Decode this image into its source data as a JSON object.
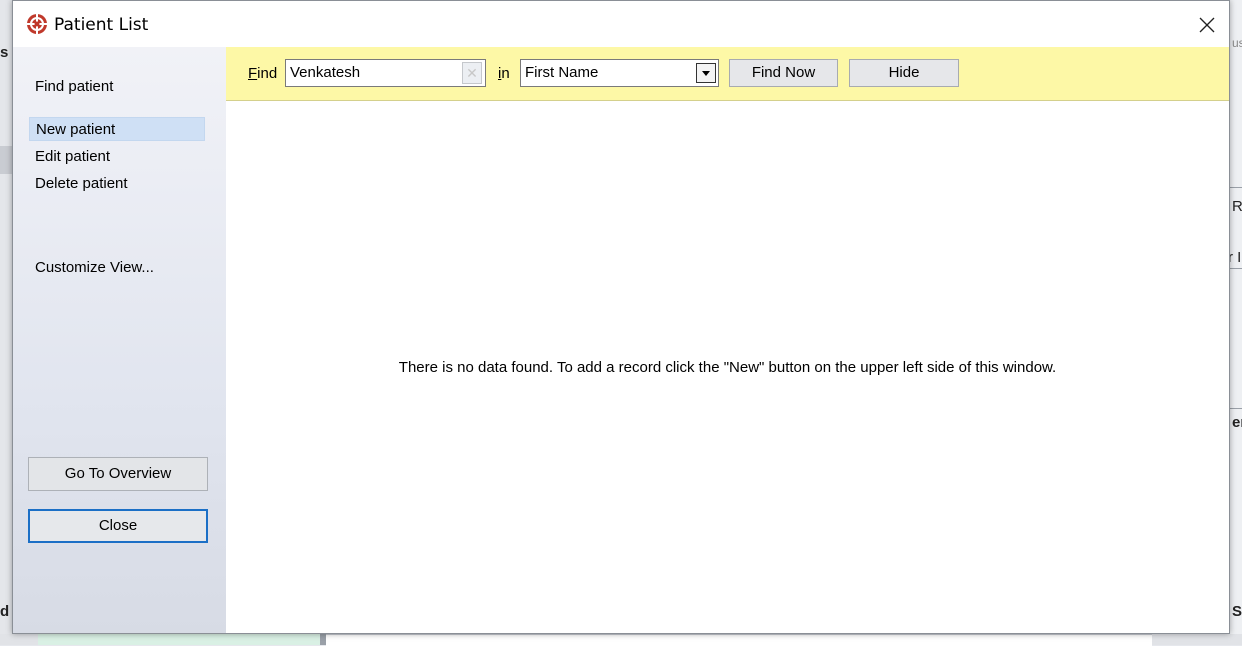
{
  "window": {
    "title": "Patient List"
  },
  "sidebar": {
    "find_patient": "Find patient",
    "new_patient": "New patient",
    "edit_patient": "Edit patient",
    "delete_patient": "Delete patient",
    "customize_view": "Customize View...",
    "go_to_overview": "Go To Overview",
    "close": "Close"
  },
  "find_bar": {
    "find_label_prefix": "F",
    "find_label_rest": "ind",
    "search_value": "Venkatesh",
    "in_label_prefix": "i",
    "in_label_rest": "n",
    "field_selected": "First Name",
    "find_now": "Find Now",
    "hide": "Hide"
  },
  "content": {
    "empty_message": "There is no data found.  To add a record click the \"New\" button on the upper left side of this window."
  },
  "background": {
    "left_fragments": [
      "s",
      "d"
    ],
    "right_fragments": [
      "us",
      "Re",
      "r I",
      "er",
      "S"
    ]
  },
  "colors": {
    "find_bar_bg": "#fdf8a6",
    "selected_item_bg": "#cfe0f5",
    "focus_border": "#1b6fc6",
    "app_icon": "#c0392b"
  }
}
